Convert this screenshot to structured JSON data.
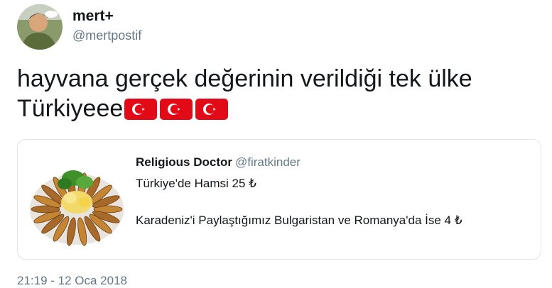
{
  "author": {
    "display_name": "mert+",
    "handle": "@mertpostif"
  },
  "tweet": {
    "text": "hayvana gerçek değerinin verildiği tek ülke Türkiyeee",
    "flag_count": 3,
    "flag_icon": "turkey-flag-icon",
    "flag_color": "#e30a17"
  },
  "quoted": {
    "display_name": "Religious Doctor",
    "handle": "@firatkinder",
    "line1": "Türkiye'de Hamsi 25 ₺",
    "line2": "Karadeniz'i Paylaştığımız Bulgaristan ve Romanya'da İse 4 ₺"
  },
  "timestamp": "21:19 - 12 Oca 2018",
  "colors": {
    "text": "#14171a",
    "secondary": "#657786",
    "border": "#dfe5ea"
  }
}
